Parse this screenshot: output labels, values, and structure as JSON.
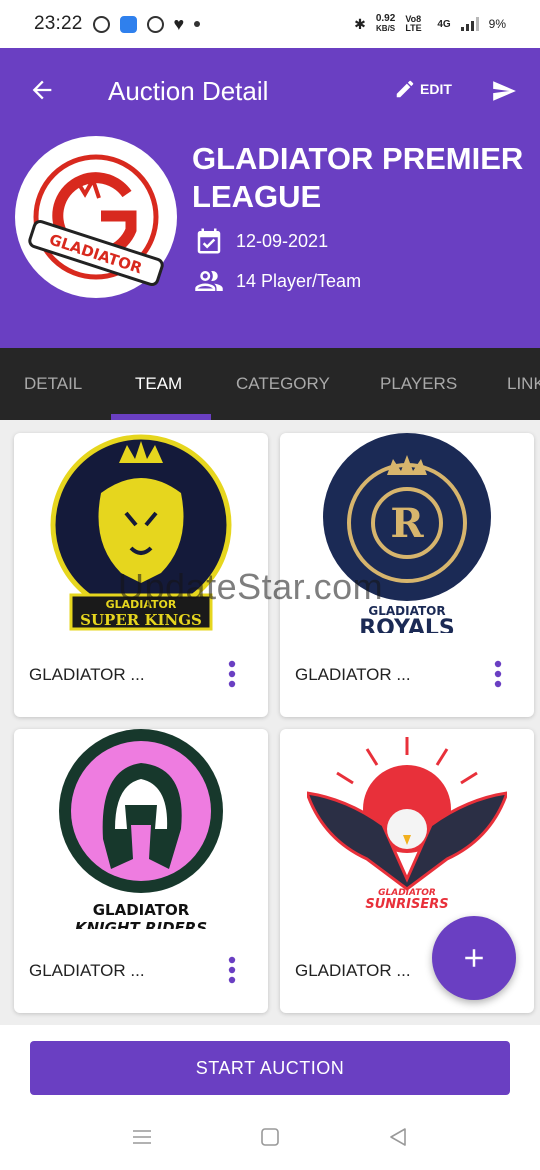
{
  "status_bar": {
    "time": "23:22",
    "speed_value": "0.92",
    "speed_unit": "KB/S",
    "volte": "Vo8 LTE",
    "network": "4G",
    "battery": "9%"
  },
  "header": {
    "title": "Auction Detail",
    "edit_label": "EDIT",
    "league_name": "GLADIATOR PREMIER LEAGUE",
    "date": "12-09-2021",
    "players_per_team": "14 Player/Team",
    "logo_text": "GLADIATOR"
  },
  "tabs": [
    {
      "label": "DETAIL",
      "active": false
    },
    {
      "label": "TEAM",
      "active": true
    },
    {
      "label": "CATEGORY",
      "active": false
    },
    {
      "label": "PLAYERS",
      "active": false
    },
    {
      "label": "LINK",
      "active": false
    }
  ],
  "teams": [
    {
      "name": "GLADIATOR ...",
      "logo_line1": "GLADIATOR",
      "logo_line2": "SUPER KINGS"
    },
    {
      "name": "GLADIATOR ...",
      "logo_line1": "GLADIATOR",
      "logo_line2": "ROYALS"
    },
    {
      "name": "GLADIATOR ...",
      "logo_line1": "GLADIATOR",
      "logo_line2": "KNIGHT RIDERS"
    },
    {
      "name": "GLADIATOR ...",
      "logo_line1": "GLADIATOR",
      "logo_line2": "SUNRISERS"
    }
  ],
  "watermark": "UpdateStar.com",
  "start_button": "START AUCTION",
  "colors": {
    "primary": "#6a3fc2",
    "tab_bar": "#262626"
  },
  "icons": {
    "back": "arrow-left-icon",
    "edit": "pencil-icon",
    "send": "send-icon",
    "date": "calendar-check-icon",
    "players": "people-icon",
    "more": "kebab-icon",
    "add": "plus-icon"
  }
}
